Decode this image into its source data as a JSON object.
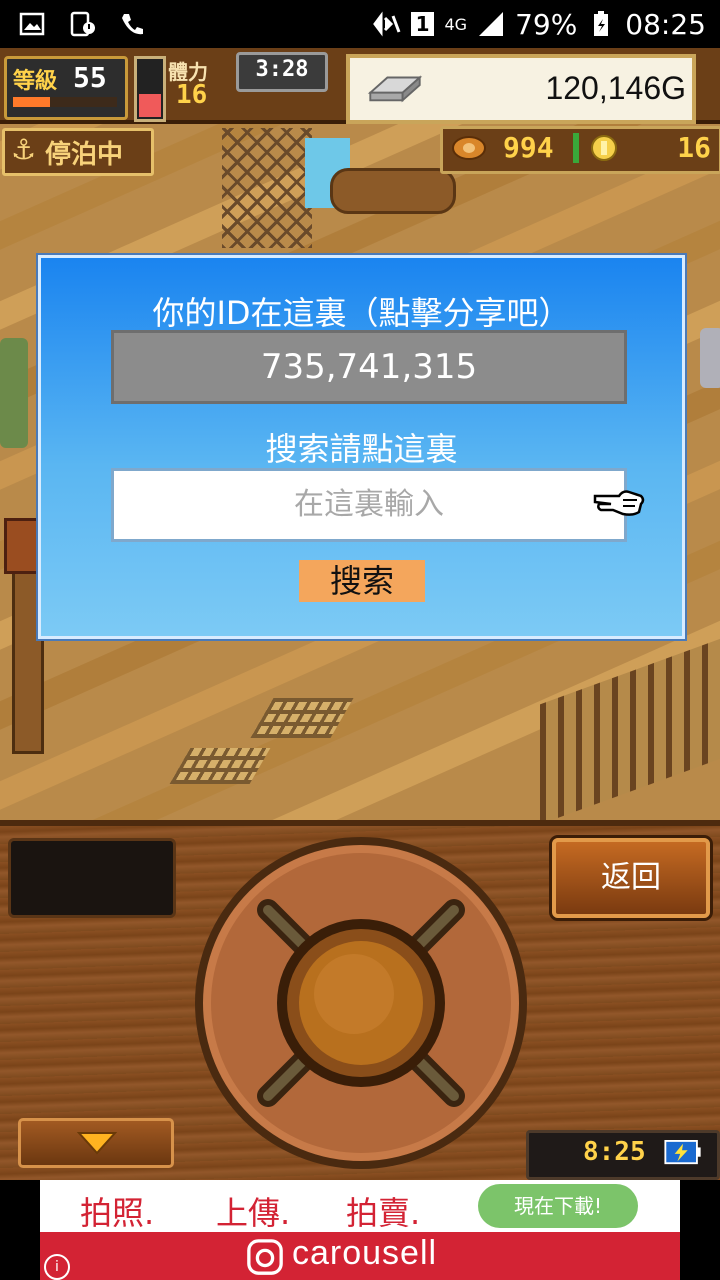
{
  "status_bar": {
    "battery": "79%",
    "time": "08:25",
    "sim": "1",
    "network": "4G"
  },
  "hud": {
    "level_label": "等級",
    "level_value": "55",
    "stamina_label": "體力",
    "stamina_value": "16",
    "timer": "3:28",
    "gold": "120,146G",
    "status_label": "停泊中",
    "food_count": "994",
    "medal_count": "16"
  },
  "dialog": {
    "title": "你的ID在這裏（點擊分享吧）",
    "id_value": "735,741,315",
    "search_label": "搜索請點這裏",
    "search_placeholder": "在這裏輸入",
    "search_button": "搜索"
  },
  "panel": {
    "back_button": "返回",
    "clock": "8:25"
  },
  "ad": {
    "line1_a": "拍照.",
    "line1_b": "上傳.",
    "line1_c": "拍賣.",
    "cta": "現在下載!",
    "brand": "carousell",
    "info": "i"
  },
  "colors": {
    "dialog_top": "#1a84f0",
    "dialog_bottom": "#7ccaf5",
    "search_button": "#f4a65c",
    "ad_red": "#d32334",
    "ad_green": "#7cc46a"
  }
}
